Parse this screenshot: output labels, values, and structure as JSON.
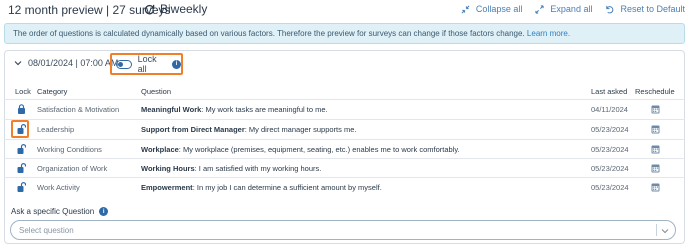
{
  "header": {
    "title": "12 month preview | 27 surveys",
    "frequency": "Biweekly",
    "actions": {
      "collapse_all": "Collapse all",
      "expand_all": "Expand all",
      "reset_default": "Reset to Default"
    }
  },
  "info_bar": {
    "text": "The order of questions is calculated dynamically based on various factors. Therefore the preview for surveys can change if those factors change.",
    "link": "Learn more."
  },
  "group": {
    "date_label": "08/01/2024 | 07:00 AM",
    "lock_all_label": "Lock all",
    "lock_all_on": false
  },
  "table": {
    "headers": {
      "lock": "Lock",
      "category": "Category",
      "question": "Question",
      "last_asked": "Last asked",
      "reschedule": "Reschedule"
    },
    "rows": [
      {
        "locked": true,
        "category": "Satisfaction & Motivation",
        "question_title": "Meaningful Work",
        "question_text": ": My work tasks are meaningful to me.",
        "last_asked": "04/11/2024"
      },
      {
        "locked": false,
        "category": "Leadership",
        "question_title": "Support from Direct Manager",
        "question_text": ": My direct manager supports me.",
        "last_asked": "05/23/2024"
      },
      {
        "locked": false,
        "category": "Working Conditions",
        "question_title": "Workplace",
        "question_text": ": My workplace (premises, equipment, seating, etc.) enables me to work comfortably.",
        "last_asked": "05/23/2024"
      },
      {
        "locked": false,
        "category": "Organization of Work",
        "question_title": "Working Hours",
        "question_text": ": I am satisfied with my working hours.",
        "last_asked": "05/23/2024"
      },
      {
        "locked": false,
        "category": "Work Activity",
        "question_title": "Empowerment",
        "question_text": ": In my job I can determine a sufficient amount by myself.",
        "last_asked": "05/23/2024"
      }
    ]
  },
  "ask_specific": {
    "label": "Ask a specific Question",
    "placeholder": "Select question"
  },
  "colors": {
    "accent": "#2f6aa8",
    "highlight": "#f07f2c",
    "info_bg": "#dff0f7"
  }
}
